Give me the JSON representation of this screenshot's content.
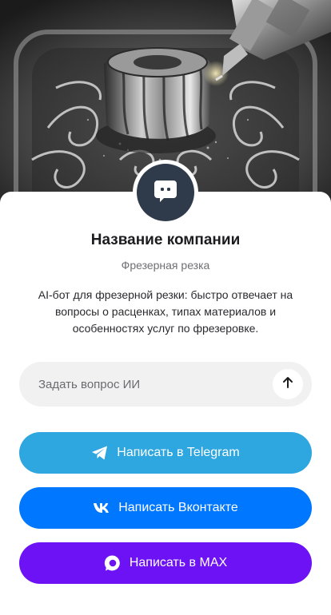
{
  "hero": {
    "icon": "cnc-milling-photo"
  },
  "profile": {
    "avatar_icon": "chat-bubble-icon",
    "company_name": "Название компании",
    "category": "Фрезерная резка",
    "description": "AI-бот для фрезерной резки: быстро отвечает на вопросы о расценках, типах материалов и особенностях услуг по фрезеровке."
  },
  "ask": {
    "placeholder": "Задать вопрос ИИ",
    "value": "",
    "send_icon": "arrow-up-icon"
  },
  "buttons": {
    "telegram": {
      "label": "Написать в Telegram",
      "icon": "telegram-icon",
      "color": "#2ea6e0"
    },
    "vk": {
      "label": "Написать Вконтакте",
      "icon": "vk-icon",
      "color": "#0077ff"
    },
    "max": {
      "label": "Написать в MAX",
      "icon": "max-icon",
      "color": "#6d12f5"
    }
  },
  "colors": {
    "avatar_bg": "#2f3a4a",
    "input_bg": "#f1f1f2",
    "text_primary": "#1c1c1e",
    "text_secondary": "#6f6f74"
  }
}
